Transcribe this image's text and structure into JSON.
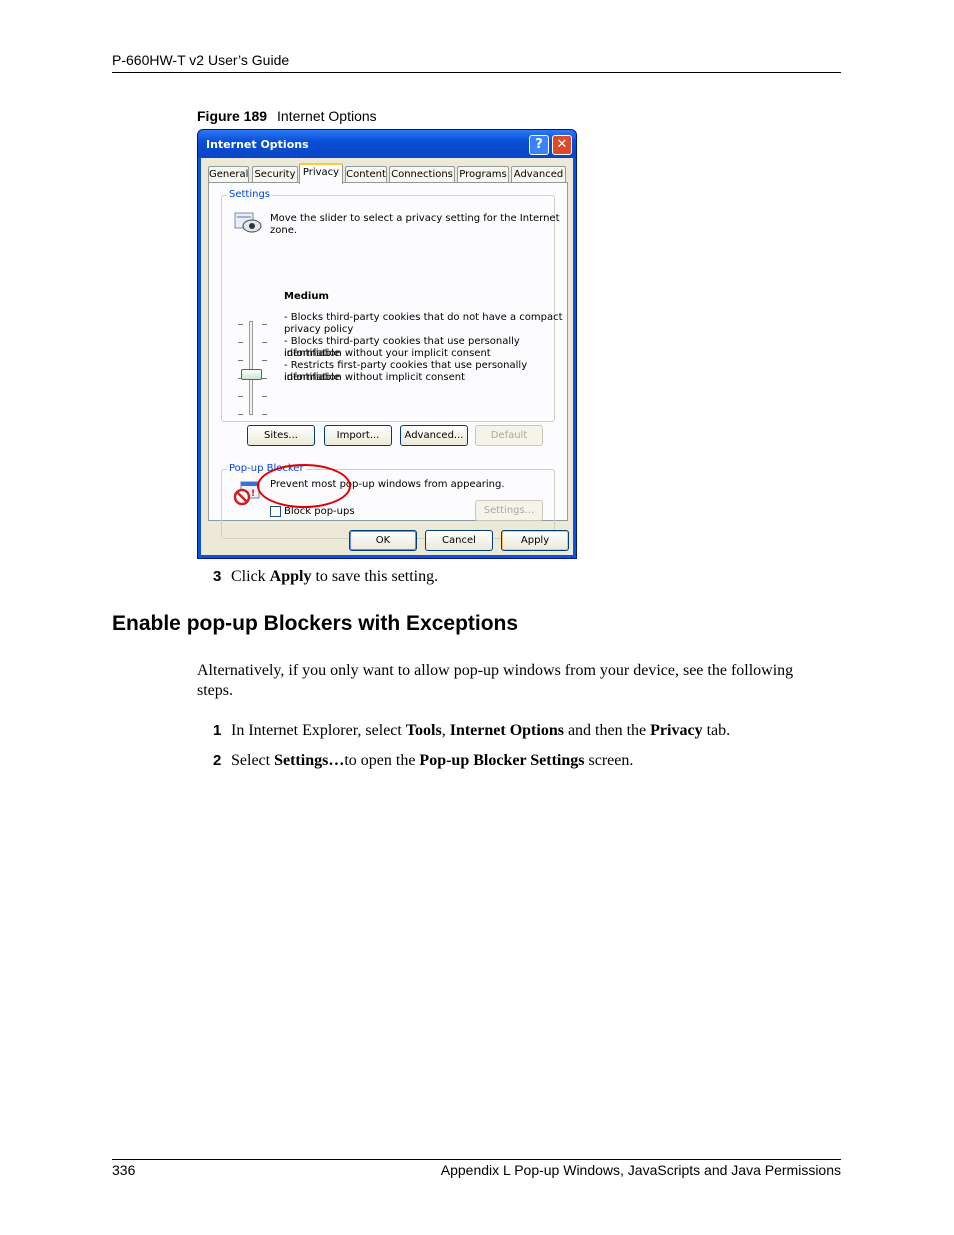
{
  "header": {
    "title": "P-660HW-T v2 User’s Guide"
  },
  "figure": {
    "number": "Figure 189",
    "title": "Internet Options"
  },
  "dialog": {
    "title": "Internet Options",
    "help_glyph": "?",
    "close_glyph": "✕",
    "tabs": [
      "General",
      "Security",
      "Privacy",
      "Content",
      "Connections",
      "Programs",
      "Advanced"
    ],
    "active_tab": "Privacy",
    "settings": {
      "group_label": "Settings",
      "intro_line1": "Move the slider to select a privacy setting for the Internet",
      "intro_line2": "zone.",
      "level": "Medium",
      "slider_level_fraction": 0.6,
      "desc": [
        "- Blocks third-party cookies that do not have a compact",
        "privacy policy",
        "- Blocks third-party cookies that use personally identifiable",
        "information without your implicit consent",
        "- Restricts first-party cookies that use personally identifiable",
        "information without implicit consent"
      ],
      "buttons": {
        "sites": "Sites...",
        "import": "Import...",
        "advanced": "Advanced...",
        "default": "Default"
      }
    },
    "popup": {
      "group_label": "Pop-up Blocker",
      "text": "Prevent most pop-up windows from appearing.",
      "checkbox_label": "Block pop-ups",
      "checkbox_checked": false,
      "settings_button": "Settings..."
    },
    "footer_buttons": {
      "ok": "OK",
      "cancel": "Cancel",
      "apply": "Apply"
    }
  },
  "step3": {
    "num": "3",
    "pre": "Click ",
    "bold": "Apply",
    "post": " to save this setting."
  },
  "section": {
    "heading": "Enable pop-up Blockers with Exceptions"
  },
  "intro": {
    "line1": "Alternatively, if you only want to allow pop-up windows from your device, see the following",
    "line2": "steps."
  },
  "steps": {
    "s1": {
      "num": "1",
      "t1": "In Internet Explorer, select ",
      "b1": "Tools",
      "t2": ", ",
      "b2": "Internet Options",
      "t3": " and then the ",
      "b3": "Privacy",
      "t4": " tab."
    },
    "s2": {
      "num": "2",
      "t1": "Select ",
      "b1": "Settings…",
      "t2": "to open the ",
      "b2": "Pop-up Blocker Settings",
      "t3": " screen."
    }
  },
  "footer": {
    "page": "336",
    "chapter": "Appendix L Pop-up Windows, JavaScripts and Java Permissions"
  }
}
